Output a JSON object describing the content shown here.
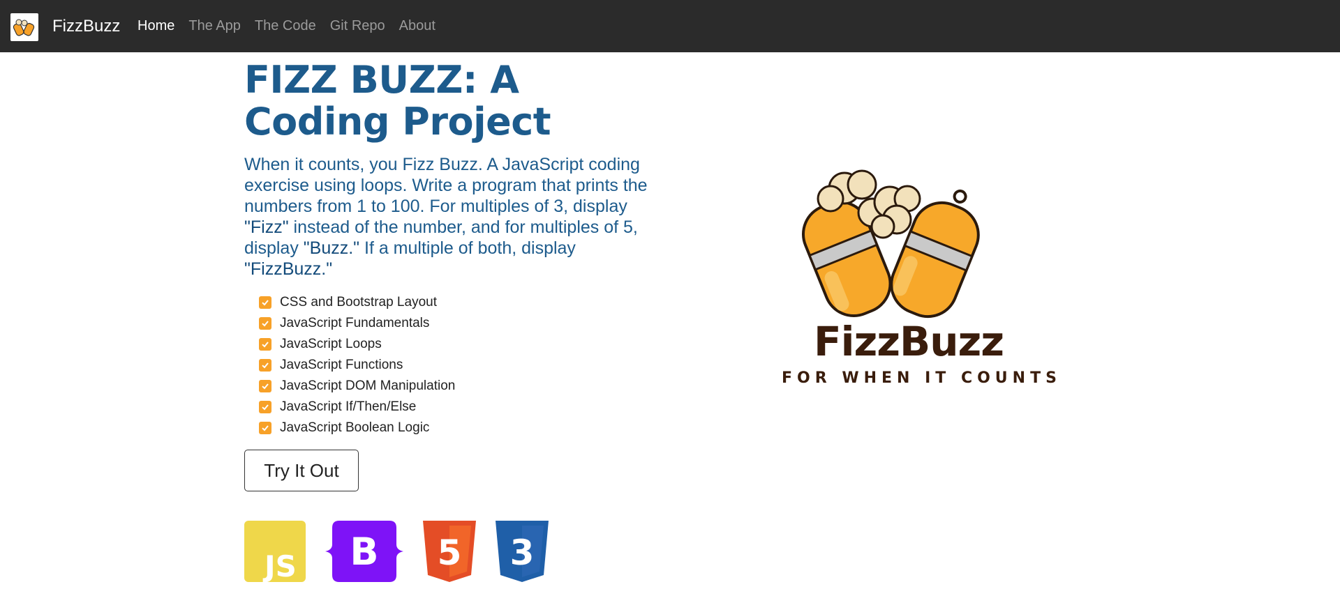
{
  "navbar": {
    "brand": "FizzBuzz",
    "links": [
      "Home",
      "The App",
      "The Code",
      "Git Repo",
      "About"
    ]
  },
  "main": {
    "title": "FIZZ BUZZ: A Coding Project",
    "lead": {
      "part1": "When it counts, you Fizz Buzz. A JavaScript coding exercise using loops. Write a program that prints the numbers from 1 to 100. For multiples of 3, display ",
      "fizz": "\"Fizz\"",
      "part2": " instead of the number, and for multiples of 5, display ",
      "buzz": "\"Buzz.\"",
      "part3": " If a multiple of both, display ",
      "fizzbuzz": "\"FizzBuzz.\""
    },
    "features": [
      "CSS and Bootstrap Layout",
      "JavaScript Fundamentals",
      "JavaScript Loops",
      "JavaScript Functions",
      "JavaScript DOM Manipulation",
      "JavaScript If/Then/Else",
      "JavaScript Boolean Logic"
    ],
    "button": "Try It Out",
    "tech_icons": [
      {
        "icon": "javascript-icon",
        "label": "JS"
      },
      {
        "icon": "bootstrap-icon",
        "label": "B"
      },
      {
        "icon": "html5-icon",
        "label": "5"
      },
      {
        "icon": "css3-icon",
        "label": "3"
      }
    ]
  },
  "hero": {
    "title": "FizzBuzz",
    "tagline": "FOR WHEN IT COUNTS"
  },
  "colors": {
    "navbar": "#2b2b2b",
    "title": "#1d5b8c",
    "check": "#f7a128",
    "js": "#efd74a",
    "bootstrap": "#7e13f7",
    "html5": "#e44d26",
    "css3": "#264de4"
  }
}
